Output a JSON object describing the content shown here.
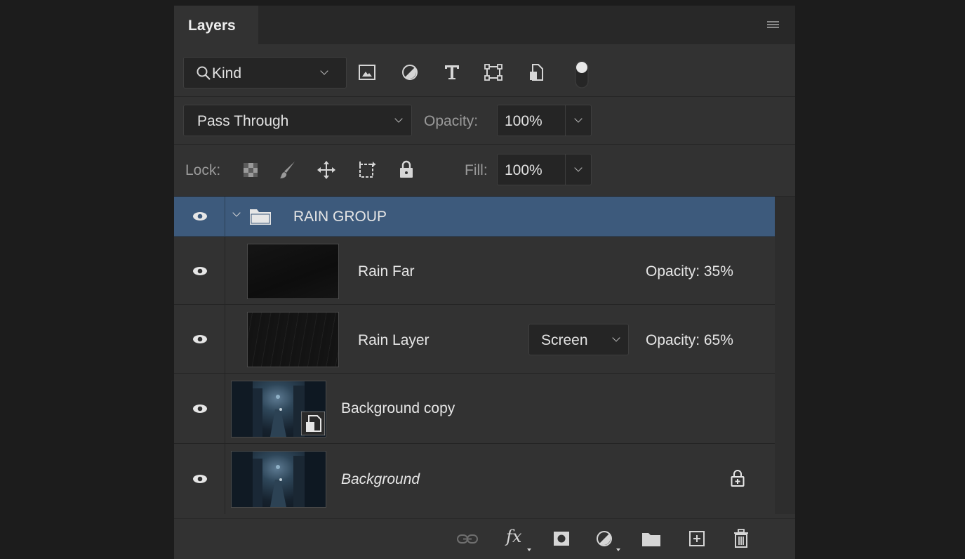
{
  "panel": {
    "tab_title": "Layers",
    "menu_icon": "hamburger-menu-icon"
  },
  "filter": {
    "kind_label": "Kind",
    "kind_icon": "search-icon",
    "icons": [
      "image-filter-icon",
      "adjustment-filter-icon",
      "type-filter-icon",
      "shape-filter-icon",
      "smart-object-filter-icon",
      "filter-toggle-icon"
    ]
  },
  "blend": {
    "mode": "Pass Through",
    "opacity_label": "Opacity:",
    "opacity_value": "100%"
  },
  "lock": {
    "label": "Lock:",
    "icons": [
      "lock-transparent-pixels-icon",
      "lock-image-pixels-icon",
      "lock-position-icon",
      "lock-artboard-icon",
      "lock-all-icon"
    ],
    "fill_label": "Fill:",
    "fill_value": "100%"
  },
  "layers": [
    {
      "name": "RAIN GROUP",
      "type": "group",
      "selected": true,
      "visible": true
    },
    {
      "name": "Rain Far",
      "type": "pixel",
      "visible": true,
      "opacity_text": "Opacity: 35%"
    },
    {
      "name": "Rain Layer",
      "type": "pixel",
      "visible": true,
      "blend_mode": "Screen",
      "opacity_text": "Opacity: 65%"
    },
    {
      "name": "Background copy",
      "type": "smart-object",
      "visible": true
    },
    {
      "name": "Background",
      "type": "background",
      "visible": true,
      "locked": true
    }
  ],
  "footer": {
    "icons": [
      "link-layers-icon",
      "layer-style-fx-icon",
      "add-mask-icon",
      "adjustment-layer-icon",
      "new-group-icon",
      "new-layer-icon",
      "delete-layer-icon"
    ],
    "fx_label": "fx"
  },
  "colors": {
    "selected_row": "#3d5a7c",
    "panel_bg": "#323232",
    "backdrop": "#1c1c1c"
  }
}
